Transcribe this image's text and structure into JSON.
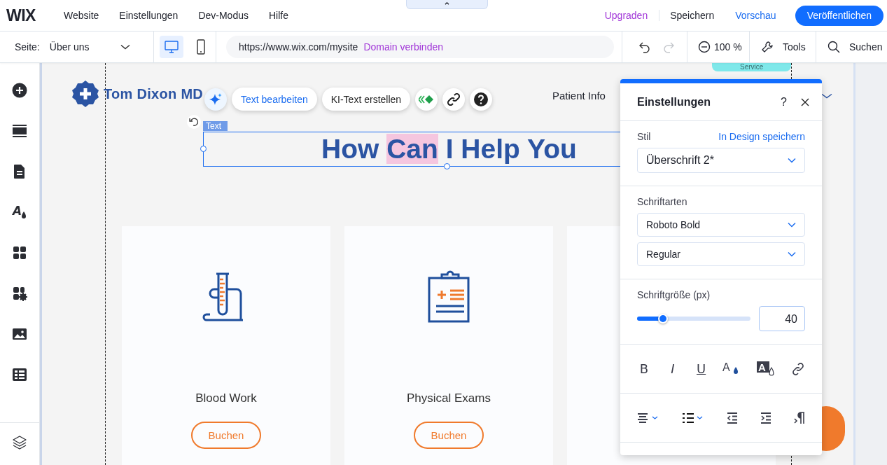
{
  "top_bar": {
    "logo": "WIX",
    "collapse": "⌃",
    "menu": [
      {
        "label": "Website"
      },
      {
        "label": "Einstellungen"
      },
      {
        "label": "Dev-Modus"
      },
      {
        "label": "Hilfe"
      }
    ],
    "actions": [
      {
        "label": "Upgraden",
        "kind": "upgrade"
      },
      {
        "label": "Speichern",
        "kind": "plain"
      },
      {
        "label": "Vorschau",
        "kind": "link"
      },
      {
        "label": "Veröffentlichen",
        "kind": "primary"
      }
    ]
  },
  "toolbar": {
    "page_label": "Seite:",
    "page": "Über uns",
    "devices": [
      {
        "kind": "desktop",
        "selected": true
      },
      {
        "kind": "mobile",
        "selected": false
      }
    ],
    "url": "https://www.wix.com/mysite",
    "domain_link": "Domain verbinden",
    "undo_disabled": false,
    "redo_disabled": true,
    "zoom": "100 %",
    "tools": "Tools",
    "search": "Suchen"
  },
  "sidebar": {
    "items": [
      {
        "kind": "add"
      },
      {
        "kind": "sections"
      },
      {
        "kind": "pages"
      },
      {
        "kind": "theme",
        "glyph": "A"
      },
      {
        "kind": "apps"
      },
      {
        "kind": "puzzle"
      },
      {
        "kind": "media"
      },
      {
        "kind": "table"
      }
    ],
    "bottom": [
      {
        "kind": "layers"
      }
    ]
  },
  "canvas": {
    "section_tag": "Service",
    "site_title": "Tom Dixon MD",
    "nav": [
      {
        "label": "Patient Info"
      }
    ],
    "element_label": "Text",
    "heading": {
      "parts": [
        {
          "text": "How ",
          "selected": false
        },
        {
          "text": "Can",
          "selected": true
        },
        {
          "text": " I Help You",
          "selected": false
        }
      ]
    },
    "float_toolbar": [
      {
        "kind": "ai"
      },
      {
        "kind": "text",
        "label": "Text bearbeiten",
        "accent": true
      },
      {
        "kind": "text",
        "label": "KI-Text erstellen",
        "accent": false
      },
      {
        "kind": "animation"
      },
      {
        "kind": "link"
      },
      {
        "kind": "help"
      }
    ],
    "cards": [
      {
        "kind": "test-tube",
        "title": "Blood Work",
        "button": "Buchen"
      },
      {
        "kind": "clipboard",
        "title": "Physical Exams",
        "button": "Buchen"
      }
    ]
  },
  "panel": {
    "title": "Einstellungen",
    "help": "?",
    "style_label": "Stil",
    "save_link": "In Design speichern",
    "style_value": "Überschrift 2*",
    "fonts_label": "Schriftarten",
    "fonts": [
      {
        "value": "Roboto Bold"
      },
      {
        "value": "Regular"
      }
    ],
    "size_label": "Schriftgröße (px)",
    "size": {
      "level": 0.23,
      "value": "40"
    },
    "format_buttons": [
      {
        "kind": "bold",
        "label": "B"
      },
      {
        "kind": "italic",
        "label": "I"
      },
      {
        "kind": "underline",
        "label": "U"
      },
      {
        "kind": "text-color",
        "label": "A"
      },
      {
        "kind": "highlight",
        "label": "A"
      },
      {
        "kind": "link"
      }
    ],
    "paragraph_buttons": [
      {
        "kind": "align"
      },
      {
        "kind": "list"
      },
      {
        "kind": "outdent"
      },
      {
        "kind": "indent"
      },
      {
        "kind": "direction"
      }
    ]
  }
}
